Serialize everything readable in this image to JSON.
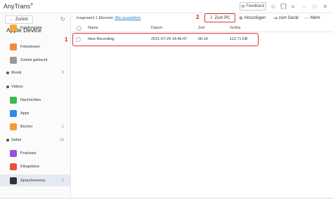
{
  "app": {
    "title": "AnyTrans",
    "registered_mark": "®",
    "feedback_label": "Feedback"
  },
  "sidebar": {
    "back_label": "Zurück",
    "device_name": "Apple Device",
    "items": [
      {
        "label": "Fotofreigabe",
        "count": "",
        "icon": "photo-sharing-icon",
        "color": "#f2a93b"
      },
      {
        "label": "Fotostream",
        "count": "",
        "icon": "photostream-icon",
        "color": "#f28a3b"
      },
      {
        "label": "Zuletzt gelöscht",
        "count": "",
        "icon": "trash-icon",
        "color": "#999999"
      },
      {
        "label": "Musik",
        "count": "3",
        "icon": "music-icon",
        "color": "#555555"
      },
      {
        "label": "Videos",
        "count": "",
        "icon": "video-icon",
        "color": "#555555"
      },
      {
        "label": "Nachrichten",
        "count": "",
        "icon": "messages-icon",
        "color": "#3fb84c"
      },
      {
        "label": "Apps",
        "count": "",
        "icon": "apps-icon",
        "color": "#2d8cf0"
      },
      {
        "label": "Bücher",
        "count": "1",
        "icon": "books-icon",
        "color": "#f29c38"
      },
      {
        "label": "Safari",
        "count": "13",
        "icon": "safari-icon",
        "color": "#555555"
      },
      {
        "label": "Podcasts",
        "count": "",
        "icon": "podcasts-icon",
        "color": "#9b4fd8"
      },
      {
        "label": "Klingeltöne",
        "count": "",
        "icon": "ringtones-icon",
        "color": "#e8513a"
      },
      {
        "label": "Sprachmemos",
        "count": "1",
        "icon": "voice-memos-icon",
        "color": "#333333"
      }
    ]
  },
  "header": {
    "selection_text": "Insgesamt 1 Element,",
    "select_all_link": "Alle auswählen"
  },
  "annotations": {
    "step1": "1",
    "step2": "2"
  },
  "toolbar": {
    "to_pc_label": "Zum PC",
    "add_label": "Hinzufügen",
    "to_device_label": "zum Gerät",
    "more_label": "Mehr"
  },
  "table": {
    "columns": [
      "Name",
      "Datum",
      "Zeit",
      "Größe"
    ],
    "rows": [
      {
        "name": "New Recording",
        "date": "2021-07-29 14:46:47",
        "time": "00:14",
        "size": "112.71 KB"
      }
    ]
  },
  "colors": {
    "highlight_red": "#d83a3a",
    "link_blue": "#3a7bd5",
    "active_item_bg": "#e5e9f2"
  }
}
